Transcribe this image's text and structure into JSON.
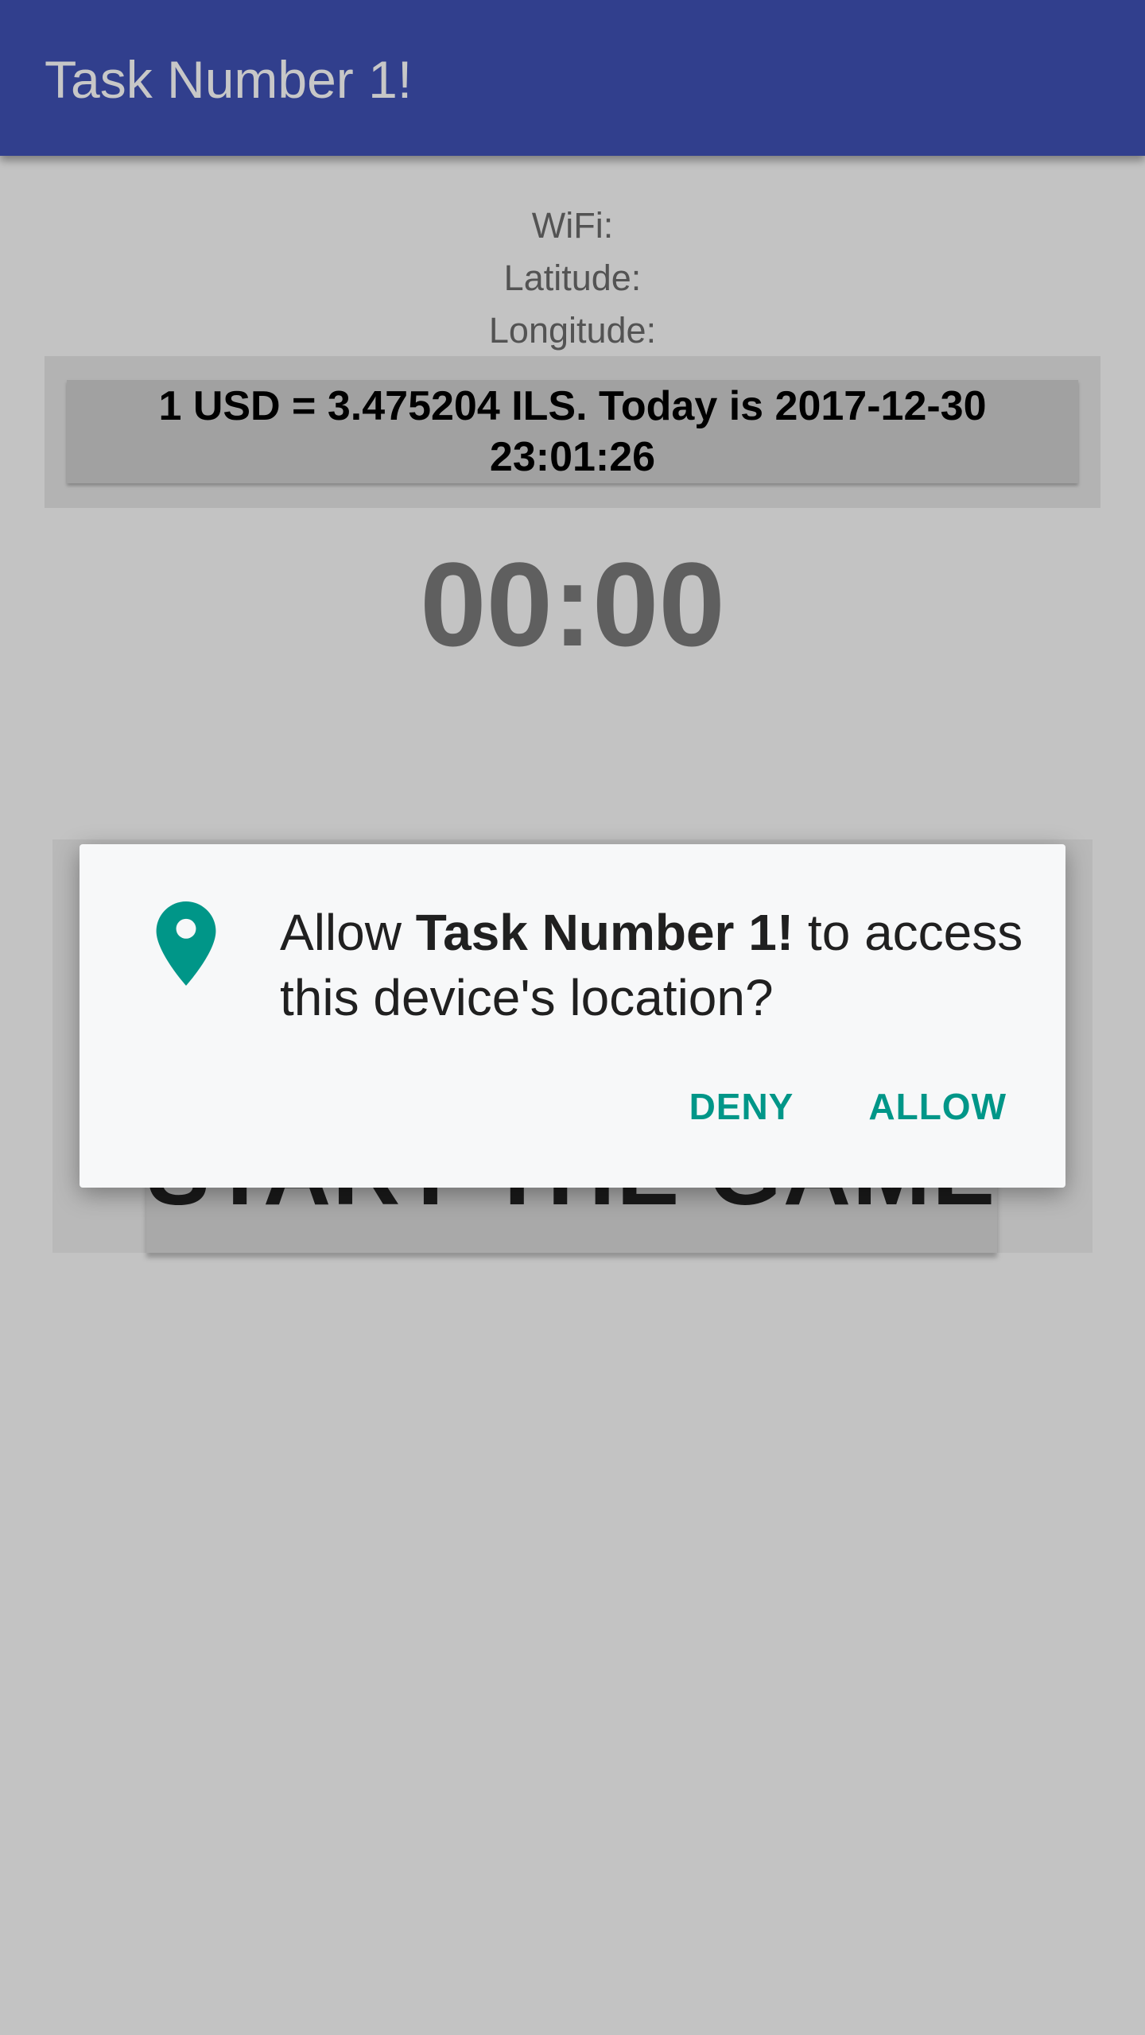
{
  "app_bar": {
    "title": "Task Number 1!"
  },
  "info": {
    "wifi_label": "WiFi:",
    "latitude_label": "Latitude:",
    "longitude_label": "Longitude:"
  },
  "exchange": {
    "text": "1 USD = 3.475204 ILS. Today is 2017-12-30 23:01:26"
  },
  "timer": {
    "value": "00:00"
  },
  "start_button": {
    "label": "START THE GAME"
  },
  "permission_dialog": {
    "icon": "location-pin-icon",
    "message_prefix": "Allow",
    "app_name": "Task Number 1!",
    "message_suffix": "to access this device's location?",
    "deny_label": "DENY",
    "allow_label": "ALLOW",
    "accent_color": "#009688"
  },
  "colors": {
    "app_bar": "#3F51B5",
    "accent": "#009688"
  }
}
